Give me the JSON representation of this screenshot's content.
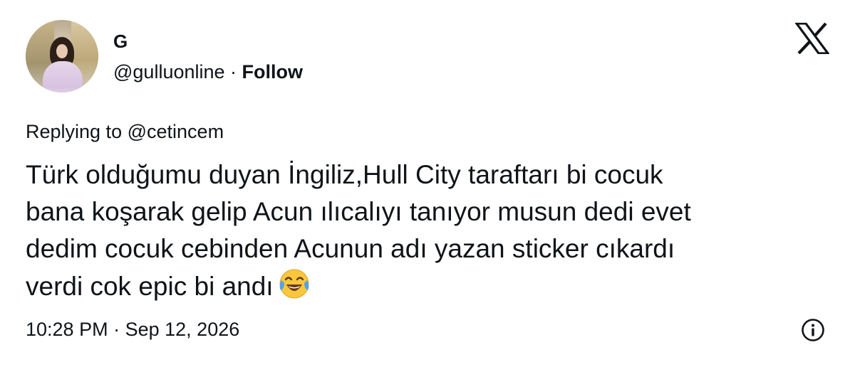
{
  "author": {
    "display_name": "G",
    "handle": "@gulluonline",
    "separator": "·",
    "follow_label": "Follow"
  },
  "reply": {
    "prefix": "Replying to",
    "mention": "@cetincem"
  },
  "tweet": {
    "lines": [
      "Türk olduğumu duyan İngiliz,Hull City taraftarı bi cocuk",
      "bana koşarak gelip Acun ılıcalıyı tanıyor musun dedi evet",
      "dedim cocuk cebinden Acunun adı yazan sticker cıkardı",
      "verdi cok epic bi andı"
    ],
    "emoji_icon": "face-with-tears-of-joy-icon"
  },
  "meta": {
    "time": "10:28 PM",
    "separator": "·",
    "date": "Sep 12, 2026"
  },
  "icons": {
    "brand": "x-logo-icon",
    "info": "info-icon"
  },
  "colors": {
    "text": "#0f1419",
    "background": "#ffffff",
    "emoji_face": "#f9c73d"
  }
}
